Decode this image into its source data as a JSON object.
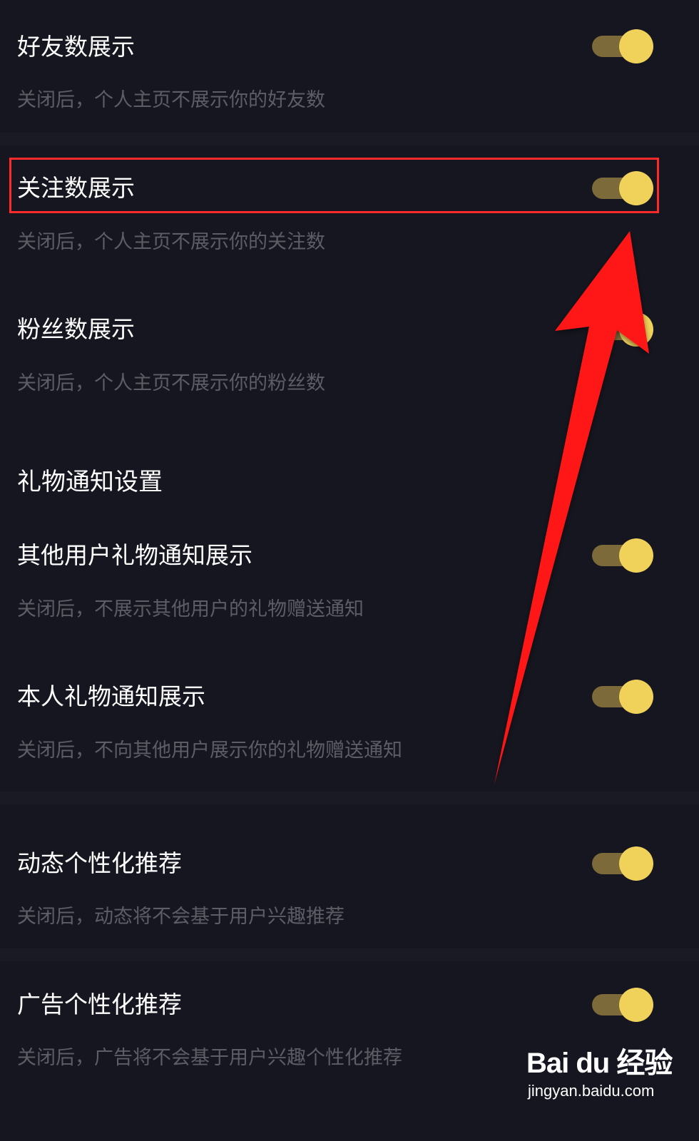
{
  "settings": [
    {
      "title": "好友数展示",
      "desc": "关闭后，个人主页不展示你的好友数",
      "enabled": true
    },
    {
      "title": "关注数展示",
      "desc": "关闭后，个人主页不展示你的关注数",
      "enabled": true
    },
    {
      "title": "粉丝数展示",
      "desc": "关闭后，个人主页不展示你的粉丝数",
      "enabled": true
    }
  ],
  "gift_section": {
    "title": "礼物通知设置",
    "items": [
      {
        "title": "其他用户礼物通知展示",
        "desc": "关闭后，不展示其他用户的礼物赠送通知",
        "enabled": true
      },
      {
        "title": "本人礼物通知展示",
        "desc": "关闭后，不向其他用户展示你的礼物赠送通知",
        "enabled": true
      }
    ]
  },
  "personalization": [
    {
      "title": "动态个性化推荐",
      "desc": "关闭后，动态将不会基于用户兴趣推荐",
      "enabled": true
    },
    {
      "title": "广告个性化推荐",
      "desc": "关闭后，广告将不会基于用户兴趣个性化推荐",
      "enabled": true
    }
  ],
  "watermark": {
    "brand": "Bai du 经验",
    "url": "jingyan.baidu.com"
  },
  "colors": {
    "background": "#161620",
    "toggle_track": "#7c6a3a",
    "toggle_knob": "#f0d25a",
    "highlight": "#ff2b2b"
  }
}
